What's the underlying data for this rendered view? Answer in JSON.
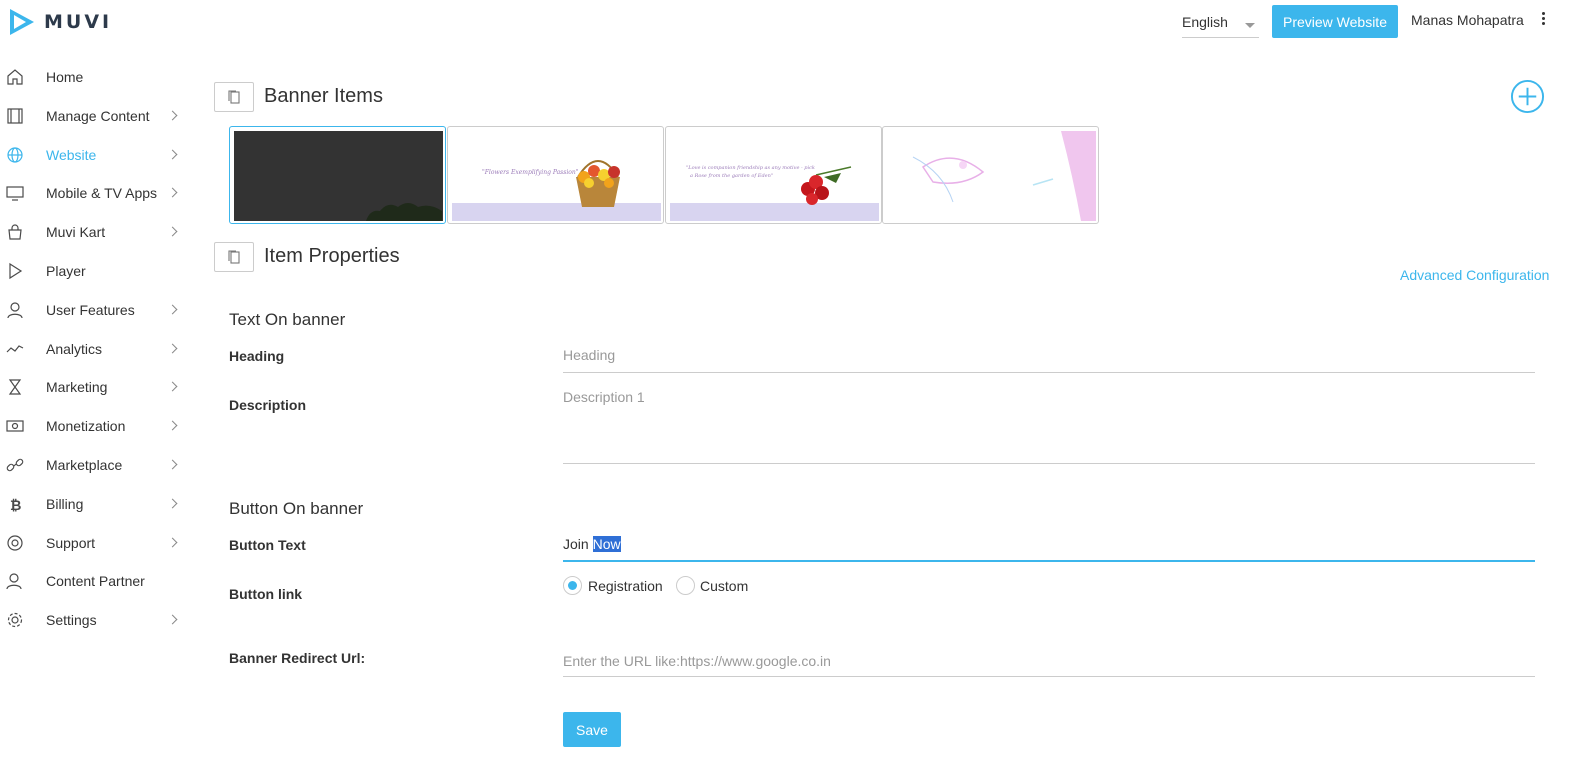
{
  "header": {
    "logo_text": "MUVI",
    "language": "English",
    "preview_button": "Preview Website",
    "user_name": "Manas Mohapatra"
  },
  "sidebar": {
    "items": [
      {
        "label": "Home",
        "icon": "home-icon",
        "has_submenu": false
      },
      {
        "label": "Manage Content",
        "icon": "film-icon",
        "has_submenu": true
      },
      {
        "label": "Website",
        "icon": "globe-icon",
        "has_submenu": true,
        "active": true
      },
      {
        "label": "Mobile & TV Apps",
        "icon": "monitor-icon",
        "has_submenu": true
      },
      {
        "label": "Muvi Kart",
        "icon": "shopping-bag-icon",
        "has_submenu": true
      },
      {
        "label": "Player",
        "icon": "play-icon",
        "has_submenu": false
      },
      {
        "label": "User Features",
        "icon": "user-icon",
        "has_submenu": true
      },
      {
        "label": "Analytics",
        "icon": "trend-line-icon",
        "has_submenu": true
      },
      {
        "label": "Marketing",
        "icon": "hourglass-icon",
        "has_submenu": true
      },
      {
        "label": "Monetization",
        "icon": "money-icon",
        "has_submenu": true
      },
      {
        "label": "Marketplace",
        "icon": "link-icon",
        "has_submenu": true
      },
      {
        "label": "Billing",
        "icon": "bitcoin-icon",
        "has_submenu": true
      },
      {
        "label": "Support",
        "icon": "lifebuoy-icon",
        "has_submenu": true
      },
      {
        "label": "Content Partner",
        "icon": "partner-icon",
        "has_submenu": false
      },
      {
        "label": "Settings",
        "icon": "gear-icon",
        "has_submenu": true
      }
    ]
  },
  "banner_items": {
    "title": "Banner Items",
    "thumbnails": [
      {
        "kind": "dark",
        "selected": true
      },
      {
        "kind": "flowers-basket",
        "caption": "\"Flowers Exemplifying Passion\""
      },
      {
        "kind": "roses",
        "caption": "\"Love is companion friendship as any motive - pick a Rose from the garden of Eden\""
      },
      {
        "kind": "pink-art"
      }
    ]
  },
  "item_properties": {
    "title": "Item Properties",
    "advanced_link": "Advanced Configuration"
  },
  "text_on_banner": {
    "title": "Text On banner",
    "heading_label": "Heading",
    "heading_placeholder": "Heading",
    "description_label": "Description",
    "description_placeholder": "Description 1"
  },
  "button_on_banner": {
    "title": "Button On banner",
    "button_text_label": "Button Text",
    "button_text_value_plain": "Join ",
    "button_text_value_selected": "Now",
    "button_link_label": "Button link",
    "options": [
      {
        "label": "Registration",
        "selected": true
      },
      {
        "label": "Custom",
        "selected": false
      }
    ],
    "redirect_label": "Banner Redirect Url:",
    "redirect_placeholder": "Enter the URL like:https://www.google.co.in"
  },
  "actions": {
    "save": "Save"
  },
  "colors": {
    "accent": "#3cb6ec",
    "text": "#333333",
    "border": "#cccccc"
  }
}
